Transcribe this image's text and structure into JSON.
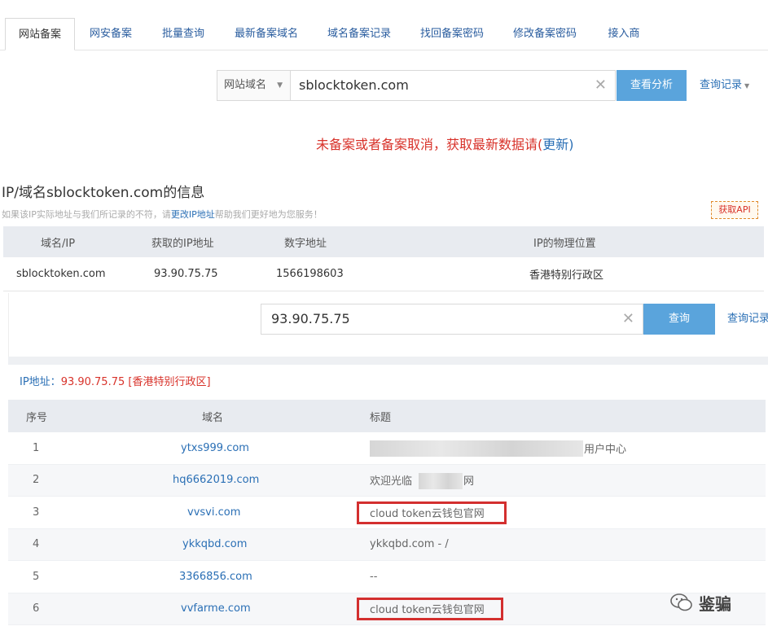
{
  "tabs": [
    {
      "label": "网站备案",
      "active": true
    },
    {
      "label": "网安备案",
      "active": false
    },
    {
      "label": "批量查询",
      "active": false
    },
    {
      "label": "最新备案域名",
      "active": false
    },
    {
      "label": "域名备案记录",
      "active": false
    },
    {
      "label": "找回备案密码",
      "active": false
    },
    {
      "label": "修改备案密码",
      "active": false
    },
    {
      "label": "接入商",
      "active": false
    }
  ],
  "search": {
    "type_label": "网站域名",
    "value": "sblocktoken.com",
    "button": "查看分析",
    "history": "查询记录"
  },
  "notice": {
    "text": "未备案或者备案取消，获取最新数据请(",
    "link": "更新",
    "close": ")"
  },
  "info": {
    "title": "IP/域名sblocktoken.com的信息",
    "sub_before": "如果该IP实际地址与我们所记录的不符，请",
    "sub_link": "更改IP地址",
    "sub_after": "帮助我们更好地为您服务！",
    "api_button": "获取API"
  },
  "ip_table": {
    "headers": [
      "域名/IP",
      "获取的IP地址",
      "数字地址",
      "IP的物理位置"
    ],
    "row": [
      "sblocktoken.com",
      "93.90.75.75",
      "1566198603",
      "香港特别行政区"
    ]
  },
  "ip_search": {
    "value": "93.90.75.75",
    "button": "查询",
    "history": "查询记录"
  },
  "ip_address": {
    "label": "IP地址：",
    "value": "93.90.75.75",
    "location": "[香港特别行政区]"
  },
  "domain_table": {
    "headers": [
      "序号",
      "域名",
      "标题"
    ],
    "rows": [
      {
        "no": "1",
        "domain": "ytxs999.com",
        "title": "用户中心"
      },
      {
        "no": "2",
        "domain": "hq6662019.com",
        "title_pre": "欢迎光临",
        "title_post": "网"
      },
      {
        "no": "3",
        "domain": "vvsvi.com",
        "title": "cloud token云钱包官网"
      },
      {
        "no": "4",
        "domain": "ykkqbd.com",
        "title": "ykkqbd.com - /"
      },
      {
        "no": "5",
        "domain": "3366856.com",
        "title": "--"
      },
      {
        "no": "6",
        "domain": "vvfarme.com",
        "title": "cloud token云钱包官网"
      }
    ]
  },
  "watermark": "鉴骗",
  "colors": {
    "accent": "#5aa4dc",
    "link": "#2a6fb5",
    "alert": "#d8322a",
    "highlight": "#d32f2f"
  }
}
